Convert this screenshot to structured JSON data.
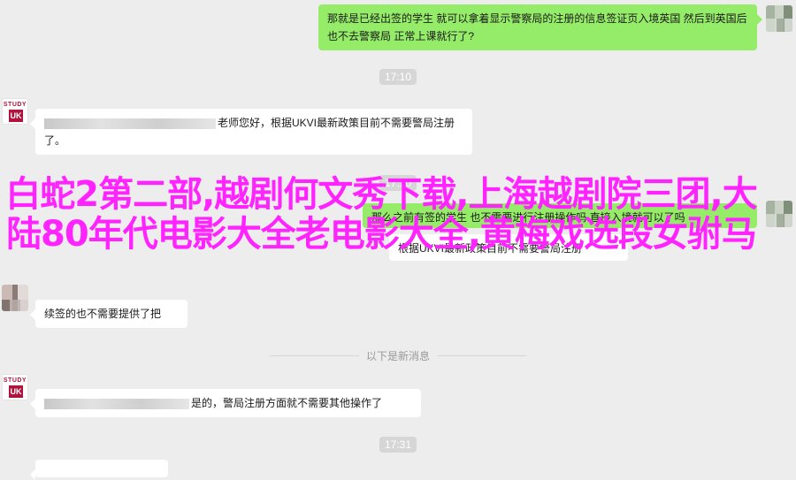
{
  "messages": [
    {
      "text": "那就是已经出签的学生 就可以拿着显示警察局的注册的信息签证页入境英国 然后到英国后也不去警察局 正常上课就行了?"
    },
    {
      "time": "17:10"
    },
    {
      "text": "老师您好，根据UKVI最新政策目前不需要警局注册了。"
    },
    {
      "time": "17:10"
    },
    {
      "text_visible": "那么之前有签的学生 也不需要进行注册操作吗 直接入境就可以了吗"
    },
    {
      "text_visible": "根据UKVI最新政策目前不需要警局注册"
    },
    {
      "text": "续签的也不需要提供了把"
    },
    {
      "divider": "以下是新消息"
    },
    {
      "text": "是的，警局注册方面就不需要其他操作了"
    },
    {
      "time": "17:31"
    }
  ],
  "overlay": {
    "text": "白蛇2第二部,越剧何文秀下载,上海越剧院三团,大陆80年代电影大全老电影大全,黄梅戏选段女驸马",
    "color": "#ff24ff"
  },
  "avatars": {
    "study_uk": {
      "line1": "STUDY",
      "line2": "UK"
    }
  }
}
